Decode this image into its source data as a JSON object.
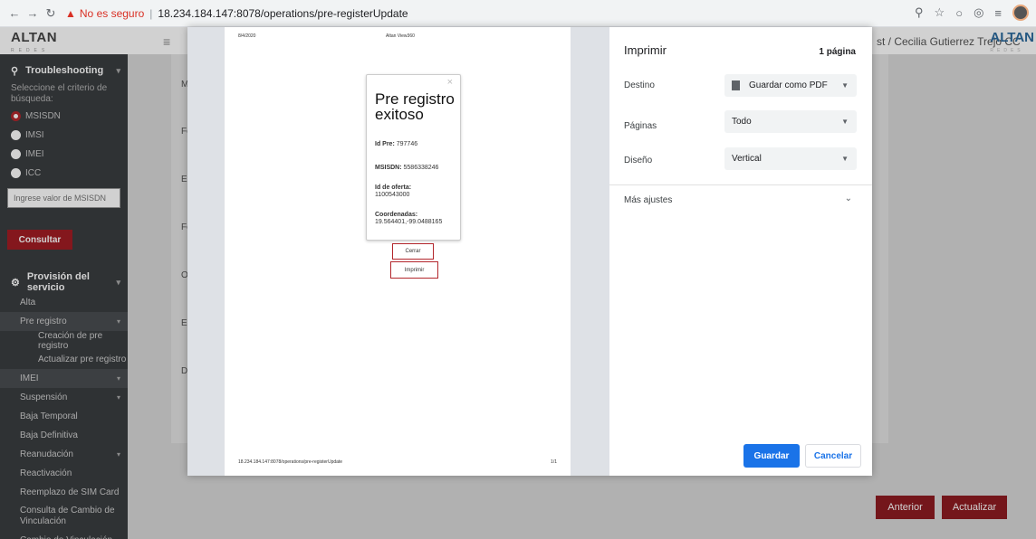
{
  "browser": {
    "security_label": "No es seguro",
    "url": "18.234.184.147:8078/operations/pre-registerUpdate"
  },
  "header": {
    "logo": "ALTAN",
    "logo_sub": "REDES",
    "user": "st / Cecilia Gutierrez Trejo CC",
    "logo_right": "ALTAN"
  },
  "sidebar": {
    "troubleshooting": "Troubleshooting",
    "hint": "Seleccione el criterio de búsqueda:",
    "radios": [
      "MSISDN",
      "IMSI",
      "IMEI",
      "ICC"
    ],
    "input_placeholder": "Ingrese valor de MSISDN",
    "consultar": "Consultar",
    "provision": "Provisión del servicio",
    "items": {
      "alta": "Alta",
      "pre_registro": "Pre registro",
      "creacion": "Creación de pre registro",
      "actualizar": "Actualizar pre registro",
      "imei": "IMEI",
      "suspension": "Suspensión",
      "baja_temporal": "Baja Temporal",
      "baja_definitiva": "Baja Definitiva",
      "reanudacion": "Reanudación",
      "reactivacion": "Reactivación",
      "reemplazo": "Reemplazo de SIM Card",
      "consulta_cambio": "Consulta de Cambio de Vinculación",
      "cambio": "Cambio de Vinculación"
    }
  },
  "main": {
    "labels": [
      "M",
      "Fe",
      "Es",
      "Fe",
      "Or",
      "En",
      "De"
    ],
    "btn_anterior": "Anterior",
    "btn_actualizar": "Actualizar"
  },
  "preview": {
    "date": "8/4/2020",
    "page_title": "Altan View360",
    "footer_url": "18.234.184.147:8078/operations/pre-registerUpdate",
    "page_num": "1/1",
    "close_glyph": "×",
    "modal_title": "Pre registro exitoso",
    "id_pre_label": "Id Pre:",
    "id_pre_value": "797746",
    "msisdn_label": "MSISDN:",
    "msisdn_value": "5586338246",
    "oferta_label": "Id de oferta:",
    "oferta_value": "1100543000",
    "coord_label": "Coordenadas:",
    "coord_value": "19.564401,-99.0488165",
    "btn_cerrar": "Cerrar",
    "btn_imprimir": "Imprimir"
  },
  "print": {
    "title": "Imprimir",
    "pages_count": "1 página",
    "destino_label": "Destino",
    "destino_value": "Guardar como PDF",
    "paginas_label": "Páginas",
    "paginas_value": "Todo",
    "diseno_label": "Diseño",
    "diseno_value": "Vertical",
    "more_settings": "Más ajustes",
    "guardar": "Guardar",
    "cancelar": "Cancelar"
  },
  "colors": {
    "brand_red": "#a11d24",
    "chrome_blue": "#1a73e8",
    "sidebar_bg": "#3a3d40"
  }
}
